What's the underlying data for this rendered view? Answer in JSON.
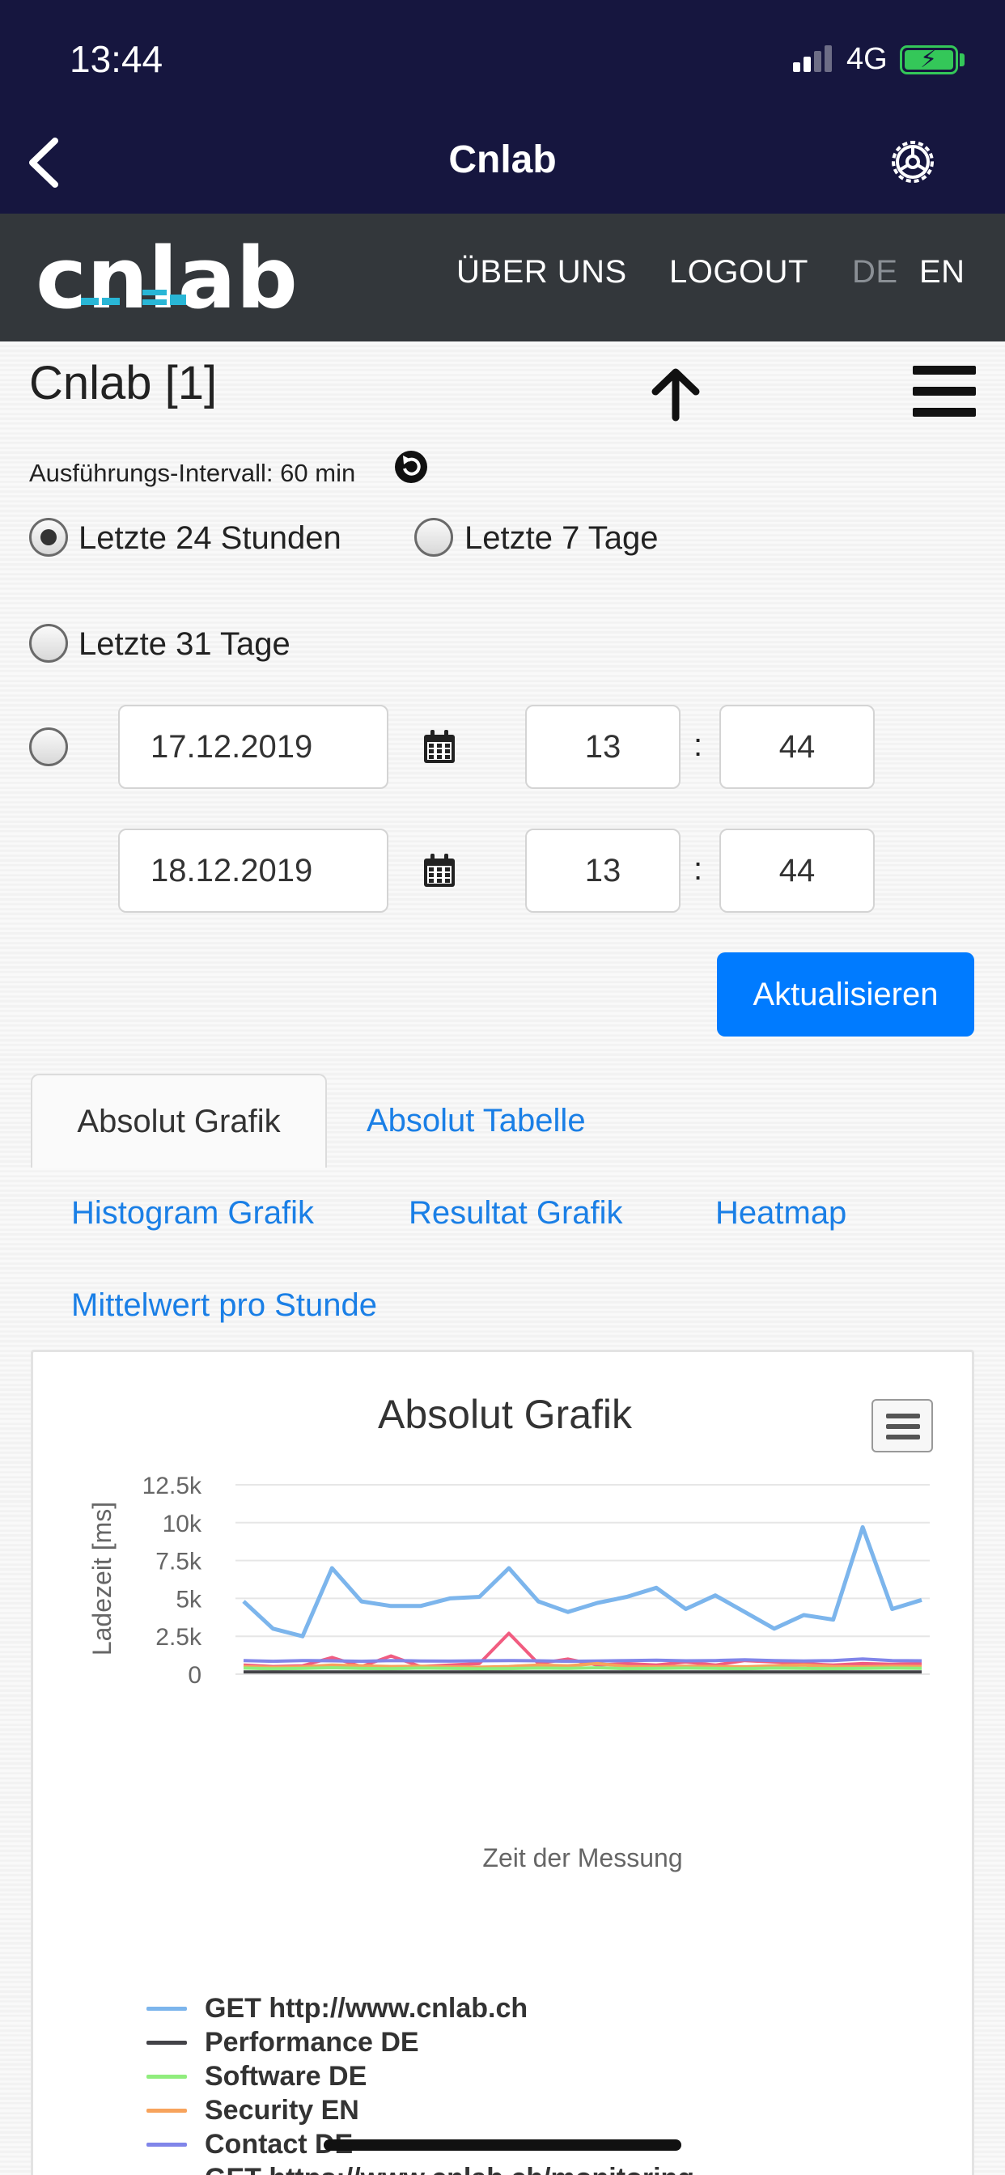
{
  "status": {
    "time": "13:44",
    "network": "4G"
  },
  "nav": {
    "title": "Cnlab"
  },
  "site": {
    "logo_text": "cnlab",
    "menu": [
      "ÜBER UNS",
      "LOGOUT"
    ],
    "languages": [
      "DE",
      "EN"
    ],
    "active_language": "EN"
  },
  "page": {
    "title": "Cnlab [1]",
    "interval": "Ausführungs-Intervall: 60 min"
  },
  "range_options": {
    "last_24h": "Letzte 24 Stunden",
    "last_7d": "Letzte 7 Tage",
    "last_31d": "Letzte 31 Tage",
    "selected": "Letzte 24 Stunden"
  },
  "custom_range": {
    "from_date": "17.12.2019",
    "from_hour": "13",
    "from_minute": "44",
    "to_date": "18.12.2019",
    "to_hour": "13",
    "to_minute": "44",
    "separator": ":"
  },
  "actions": {
    "refresh_label": "Aktualisieren"
  },
  "tabs": {
    "active": "Absolut Grafik",
    "items": [
      "Absolut Grafik",
      "Absolut Tabelle",
      "Histogram Grafik",
      "Resultat Grafik",
      "Heatmap",
      "Mittelwert pro Stunde"
    ]
  },
  "chart_data": {
    "type": "line",
    "title": "Absolut Grafik",
    "xlabel": "Zeit der Messung",
    "ylabel": "Ladezeit [ms]",
    "ylim": [
      0,
      12500
    ],
    "yticks": [
      "12.5k",
      "10k",
      "7.5k",
      "5k",
      "2.5k",
      "0"
    ],
    "ytick_values": [
      12500,
      10000,
      7500,
      5000,
      2500,
      0
    ],
    "grid": true,
    "legend_position": "bottom",
    "series": [
      {
        "name": "GET http://www.cnlab.ch",
        "color": "#7cb5ec",
        "values": [
          4800,
          3000,
          2500,
          7000,
          4800,
          4500,
          4500,
          5000,
          5100,
          7000,
          4800,
          4100,
          4700,
          5100,
          5700,
          4300,
          5200,
          4100,
          3000,
          3900,
          3600,
          9700,
          4300,
          4900
        ]
      },
      {
        "name": "Performance DE",
        "color": "#434348",
        "values": [
          150,
          150,
          150,
          150,
          150,
          150,
          150,
          150,
          150,
          150,
          150,
          150,
          150,
          150,
          150,
          150,
          150,
          150,
          150,
          150,
          150,
          150,
          150,
          150
        ]
      },
      {
        "name": "Software DE",
        "color": "#90ed7d",
        "values": [
          400,
          350,
          380,
          420,
          380,
          360,
          400,
          380,
          350,
          370,
          400,
          380,
          420,
          360,
          380,
          400,
          380,
          360,
          400,
          380,
          360,
          380,
          400,
          380
        ]
      },
      {
        "name": "Security EN",
        "color": "#f7a35c",
        "values": [
          500,
          450,
          480,
          600,
          550,
          500,
          520,
          480,
          460,
          500,
          600,
          550,
          700,
          500,
          480,
          520,
          500,
          480,
          550,
          600,
          500,
          480,
          520,
          500
        ]
      },
      {
        "name": "Contact DE",
        "color": "#8085e9",
        "values": [
          900,
          850,
          900,
          880,
          850,
          900,
          870,
          860,
          880,
          900,
          880,
          850,
          870,
          900,
          920,
          880,
          900,
          950,
          900,
          870,
          900,
          1000,
          900,
          880
        ]
      },
      {
        "name": "GET https://www.cnlab.ch/monitoring",
        "color": "#f15c80",
        "values": [
          600,
          500,
          550,
          1100,
          500,
          1200,
          500,
          600,
          700,
          2700,
          700,
          1000,
          600,
          700,
          600,
          800,
          600,
          900,
          800,
          700,
          600,
          700,
          650,
          700
        ]
      }
    ]
  }
}
